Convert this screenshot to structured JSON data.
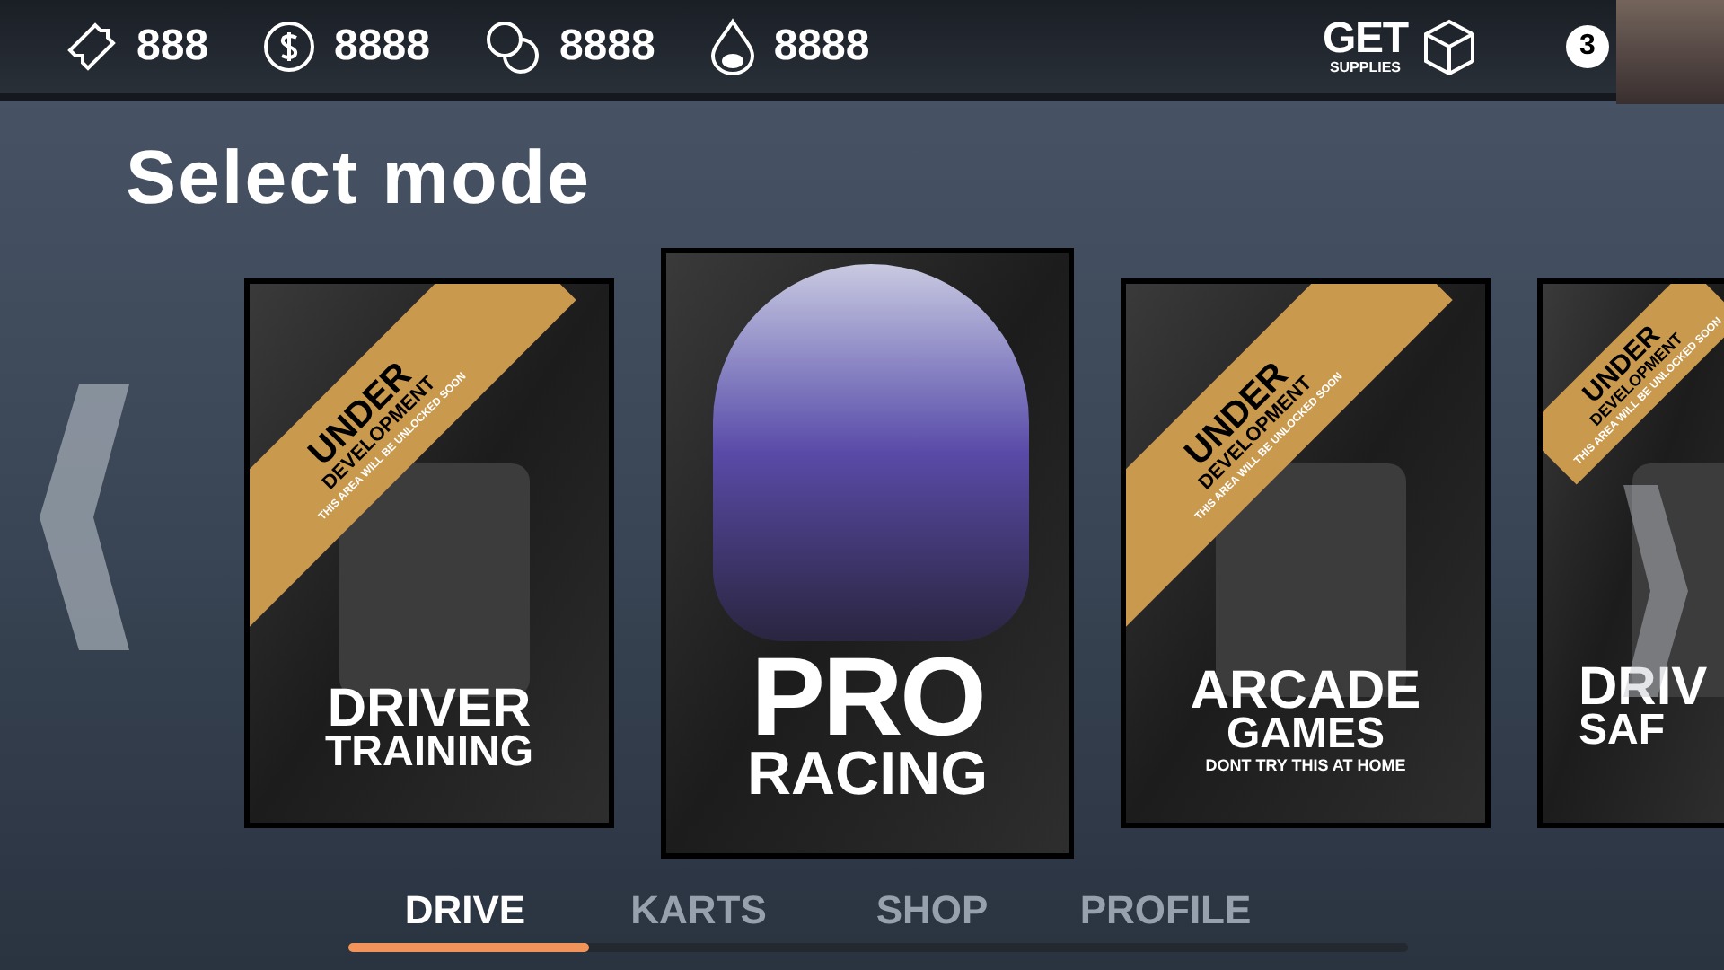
{
  "currencies": [
    {
      "kind": "ticket",
      "value": "888"
    },
    {
      "kind": "coin",
      "value": "8888"
    },
    {
      "kind": "gems",
      "value": "8888"
    },
    {
      "kind": "drop",
      "value": "8888"
    }
  ],
  "supplies": {
    "title": "GET",
    "subtitle": "SUPPLIES"
  },
  "player": {
    "level": "3"
  },
  "heading": "Select mode",
  "modes": [
    {
      "kind": "locked",
      "banner": "UNDER",
      "banner_2": "DEVELOPMENT",
      "banner_note": "THIS AREA WILL BE UNLOCKED SOON",
      "title": "DRIVER",
      "title_2": "TRAINING"
    },
    {
      "kind": "featured",
      "title": "PRO",
      "title_2": "RACING"
    },
    {
      "kind": "locked",
      "banner": "UNDER",
      "banner_2": "DEVELOPMENT",
      "banner_note": "THIS AREA WILL BE UNLOCKED SOON",
      "title": "ARCADE",
      "title_2": "GAMES",
      "subtitle": "DONT TRY THIS AT HOME"
    },
    {
      "kind": "partial",
      "banner": "UNDER",
      "banner_2": "DEVELOPMENT",
      "banner_note": "THIS AREA WILL BE UNLOCKED SOON",
      "title": "DRIV",
      "title_2": "SAF"
    }
  ],
  "tabs": [
    {
      "label": "DRIVE",
      "selected": true
    },
    {
      "label": "KARTS",
      "selected": false
    },
    {
      "label": "SHOP",
      "selected": false
    },
    {
      "label": "PROFILE",
      "selected": false
    }
  ]
}
